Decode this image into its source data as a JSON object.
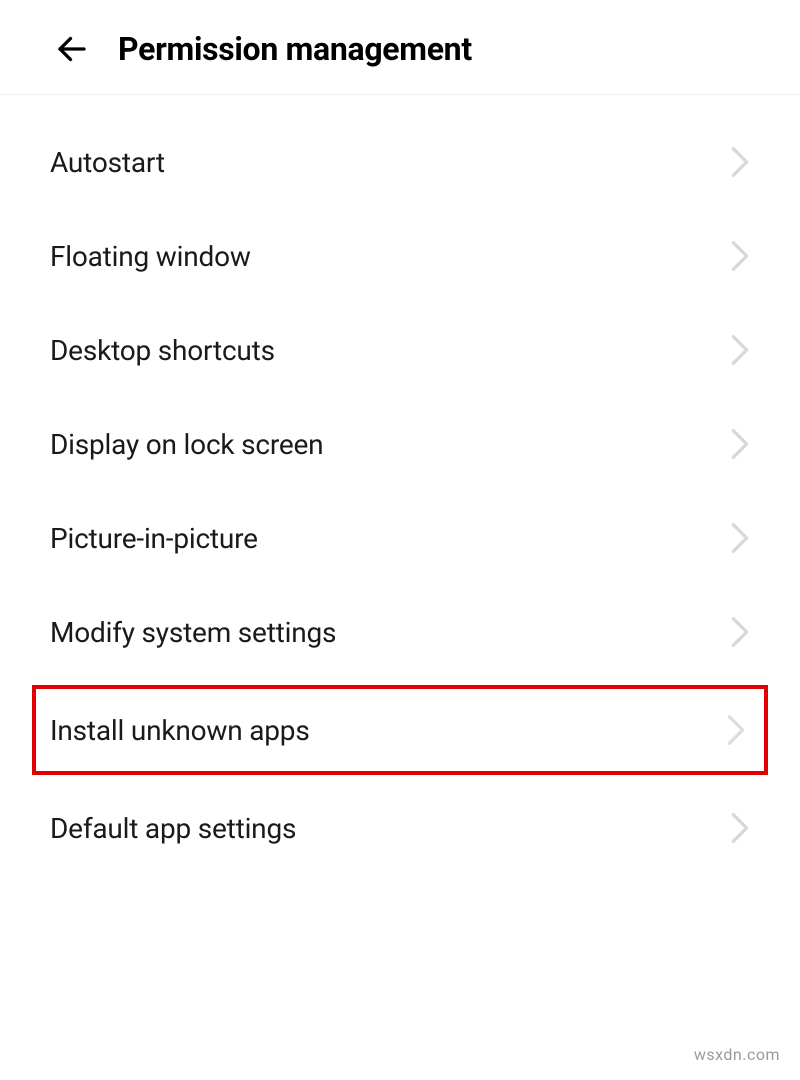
{
  "header": {
    "title": "Permission management"
  },
  "items": [
    {
      "label": "Autostart",
      "highlighted": false
    },
    {
      "label": "Floating window",
      "highlighted": false
    },
    {
      "label": "Desktop shortcuts",
      "highlighted": false
    },
    {
      "label": "Display on lock screen",
      "highlighted": false
    },
    {
      "label": "Picture-in-picture",
      "highlighted": false
    },
    {
      "label": "Modify system settings",
      "highlighted": false
    },
    {
      "label": "Install unknown apps",
      "highlighted": true
    },
    {
      "label": "Default app settings",
      "highlighted": false
    }
  ],
  "watermark": "wsxdn.com"
}
